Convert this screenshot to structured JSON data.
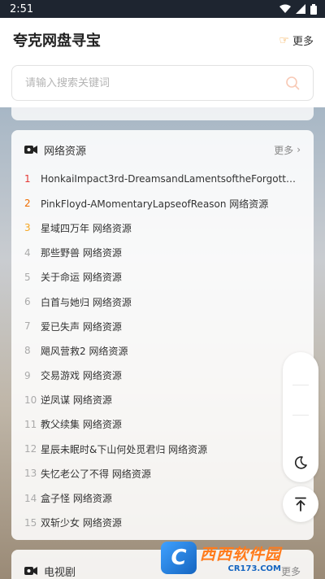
{
  "status_bar": {
    "time": "2:51"
  },
  "header": {
    "title": "夸克网盘寻宝",
    "more_label": "更多",
    "more_icon": "pointing-hand-icon"
  },
  "search": {
    "placeholder": "请输入搜索关键词",
    "value": ""
  },
  "section1": {
    "title": "网络资源",
    "more_label": "更多",
    "items": [
      {
        "rank": "1",
        "text": "HonkaiImpact3rd-DreamsandLamentsoftheForgotten…"
      },
      {
        "rank": "2",
        "text": "PinkFloyd-AMomentaryLapseofReason 网络资源"
      },
      {
        "rank": "3",
        "text": "星域四万年 网络资源"
      },
      {
        "rank": "4",
        "text": "那些野兽 网络资源"
      },
      {
        "rank": "5",
        "text": "关于命运 网络资源"
      },
      {
        "rank": "6",
        "text": "白首与她归 网络资源"
      },
      {
        "rank": "7",
        "text": "爱已失声 网络资源"
      },
      {
        "rank": "8",
        "text": "飓风营救2 网络资源"
      },
      {
        "rank": "9",
        "text": "交易游戏 网络资源"
      },
      {
        "rank": "10",
        "text": "逆凤谋 网络资源"
      },
      {
        "rank": "11",
        "text": "教父续集 网络资源"
      },
      {
        "rank": "12",
        "text": "星辰未眠时&下山何处觅君归 网络资源"
      },
      {
        "rank": "13",
        "text": "失忆老公了不得 网络资源"
      },
      {
        "rank": "14",
        "text": "盒子怪 网络资源"
      },
      {
        "rank": "15",
        "text": "双斩少女 网络资源"
      }
    ]
  },
  "section2": {
    "title": "电视剧",
    "more_label": "更多"
  },
  "watermark": {
    "name": "西西软件园",
    "url": "CR173.COM",
    "logo_letter": "C"
  },
  "colors": {
    "rank1": "#e53935",
    "rank2": "#ef6c00",
    "rank3": "#f5a623",
    "rank_default": "#aaaaaa"
  }
}
